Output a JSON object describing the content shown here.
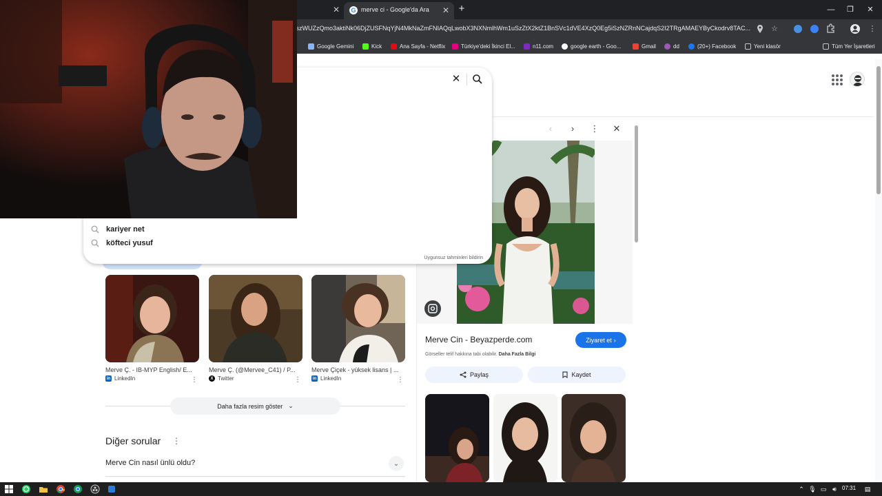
{
  "browser": {
    "active_tab_title": "merve ci - Google'da Ara",
    "url": "cszWUZzQmo3aktiNk06DjZUSFNqYjN4MkNaZmFNIAQqLwobX3NXNmlhWm1uSzZtX2ktZ1BnSVc1dVE4XzQ0Eg5iSzNZRnNCajdqS2I2TRgAMAEYByCkodrv8TAC...",
    "bookmarks": [
      {
        "label": "Google Gemini",
        "color": "#8ab4f8"
      },
      {
        "label": "Kick",
        "color": "#53fc18"
      },
      {
        "label": "Ana Sayfa - Netflix",
        "color": "#e50914"
      },
      {
        "label": "Türkiye'deki İkinci El...",
        "color": "#e6007e"
      },
      {
        "label": "n11.com",
        "color": "#7b2cbf"
      },
      {
        "label": "google earth - Goo...",
        "color": "#ffffff"
      },
      {
        "label": "Gmail",
        "color": "#ea4335"
      },
      {
        "label": "dd",
        "color": "#9b59b6"
      },
      {
        "label": "(20+) Facebook",
        "color": "#1877f2"
      },
      {
        "label": "Yeni klasör",
        "color": "#c8c8c8"
      }
    ],
    "all_bookmarks": "Tüm Yer İşaretleri"
  },
  "search": {
    "suggestions": [
      "kariyer net",
      "köfteci yusuf"
    ],
    "report_link": "Uygunsuz tahminleri bildirin"
  },
  "image_results": [
    {
      "caption": "Merve Ç. - IB-MYP English/ E...",
      "source": "LinkedIn",
      "source_icon": "linkedin-icon"
    },
    {
      "caption": "Merve Ç. (@Mervee_C41) / P...",
      "source": "Twitter",
      "source_icon": "x-icon"
    },
    {
      "caption": "Merve Çiçek - yüksek lisans | ...",
      "source": "LinkedIn",
      "source_icon": "linkedin-icon"
    }
  ],
  "more_images_label": "Daha fazla resim göster",
  "people_also_ask": {
    "title": "Diğer sorular",
    "questions": [
      "Merve Cin nasıl ünlü oldu?"
    ]
  },
  "panel": {
    "site_title": "Merve Cin - Beyazperde.com",
    "visit_label": "Ziyaret et",
    "copyright_note": "Görseller telif hakkına tabi olabilir.",
    "more_info": "Daha Fazla Bilgi",
    "share_label": "Paylaş",
    "save_label": "Kaydet"
  },
  "taskbar": {
    "clock": "07:31"
  }
}
